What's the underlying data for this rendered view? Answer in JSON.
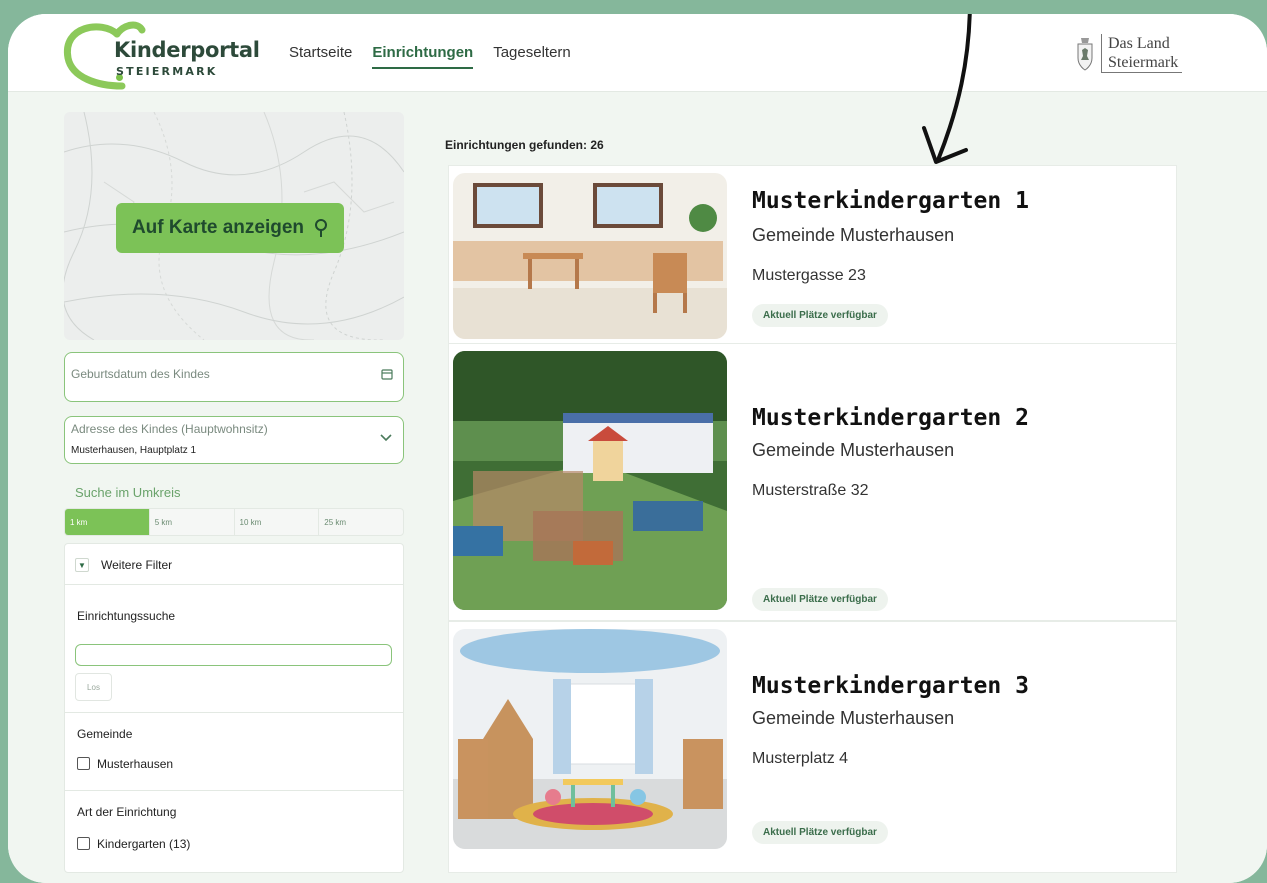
{
  "header": {
    "logo_word": "Kinderportal",
    "logo_sub": "STEIERMARK",
    "nav": [
      "Startseite",
      "Einrichtungen",
      "Tageseltern"
    ],
    "active_nav": "Einrichtungen",
    "land_line1": "Das Land",
    "land_line2": "Steiermark"
  },
  "sidebar": {
    "map_button": "Auf Karte anzeigen",
    "birthdate_label": "Geburtsdatum des Kindes",
    "address_label": "Adresse des Kindes (Hauptwohnsitz)",
    "address_value": "Musterhausen, Hauptplatz 1",
    "radius_title": "Suche im Umkreis",
    "radius_options": [
      "1 km",
      "5 km",
      "10 km",
      "25 km"
    ],
    "radius_selected": "1 km",
    "more_filters": "Weitere Filter",
    "facility_search_title": "Einrichtungssuche",
    "go_button": "Los",
    "municipality_title": "Gemeinde",
    "municipality_option": "Musterhausen",
    "type_title": "Art der Einrichtung",
    "type_option": "Kindergarten (13)"
  },
  "results": {
    "count_text": "Einrichtungen gefunden: 26",
    "items": [
      {
        "name": "Musterkindergarten 1",
        "municipality": "Gemeinde Musterhausen",
        "address": "Mustergasse 23",
        "badge": "Aktuell Plätze verfügbar"
      },
      {
        "name": "Musterkindergarten 2",
        "municipality": "Gemeinde Musterhausen",
        "address": "Musterstraße 32",
        "badge": "Aktuell Plätze verfügbar"
      },
      {
        "name": "Musterkindergarten 3",
        "municipality": "Gemeinde Musterhausen",
        "address": "Musterplatz 4",
        "badge": "Aktuell Plätze verfügbar"
      }
    ]
  },
  "colors": {
    "frame": "#85b79b",
    "accent": "#7cc257",
    "brand_dark": "#2e6b45"
  }
}
